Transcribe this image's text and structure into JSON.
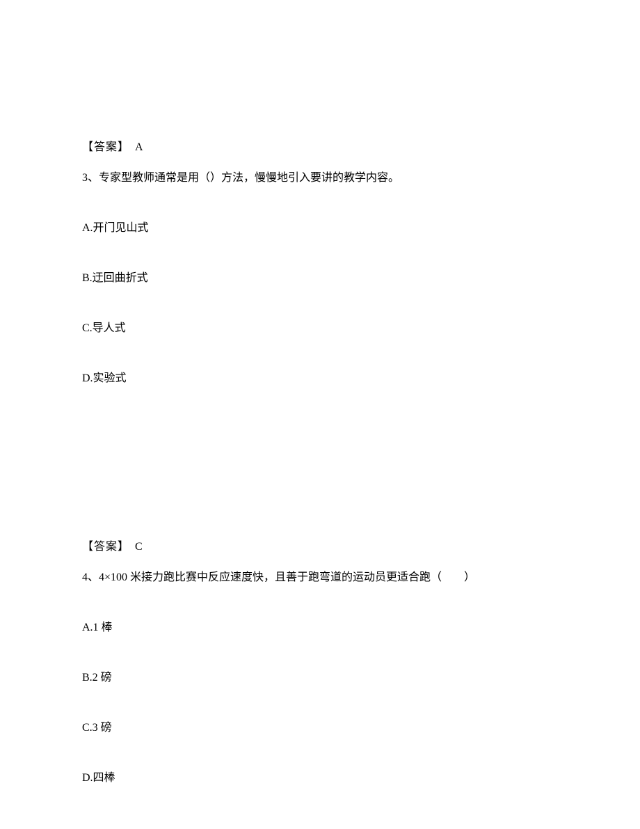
{
  "block1": {
    "answer_label": "【答案】",
    "answer_value": "A"
  },
  "q3": {
    "number": "3、",
    "text": "专家型教师通常是用（）方法，慢慢地引入要讲的教学内容。",
    "options": {
      "a": "A.开门见山式",
      "b": "B.迂回曲折式",
      "c": "C.导人式",
      "d": "D.实验式"
    }
  },
  "block2": {
    "answer_label": "【答案】",
    "answer_value": "C"
  },
  "q4": {
    "number": "4、",
    "text": "4×100 米接力跑比赛中反应速度快，且善于跑弯道的运动员更适合跑（　　）",
    "options": {
      "a": "A.1 棒",
      "b": "B.2 磅",
      "c": "C.3 磅",
      "d": "D.四棒"
    }
  }
}
